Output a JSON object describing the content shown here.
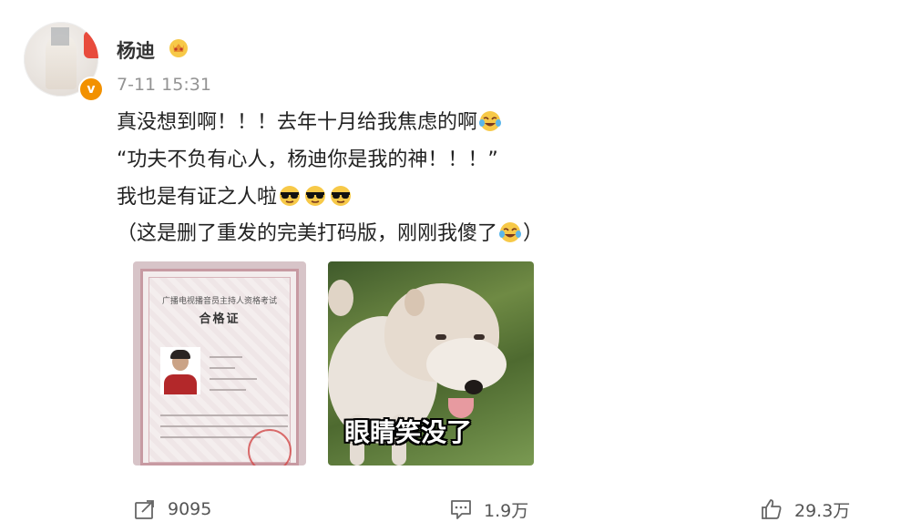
{
  "post": {
    "author": {
      "name": "杨迪",
      "verified_icon": "verified-v-icon",
      "badge_icon": "crown-emoji-icon"
    },
    "timestamp": "7-11 15:31",
    "lines": [
      "真没想到啊！！！去年十月给我焦虑的啊",
      "“功夫不负有心人，杨迪你是我的神！！！”",
      "我也是有证之人啦",
      "（这是删了重发的完美打码版，刚刚我傻了",
      "）"
    ],
    "emojis": {
      "laugh_cry": "laugh-cry-emoji-icon",
      "sunglasses": "sunglasses-emoji-icon"
    },
    "images": [
      {
        "name": "certificate",
        "title_small": "广播电视播音员主持人资格考试",
        "title_big": "合格证"
      },
      {
        "name": "dog-meme",
        "caption": "眼睛笑没了"
      }
    ],
    "actions": {
      "repost": {
        "icon": "repost-icon",
        "count": "9095"
      },
      "comment": {
        "icon": "comment-icon",
        "count": "1.9万"
      },
      "like": {
        "icon": "like-icon",
        "count": "29.3万"
      }
    }
  },
  "colors": {
    "accent_orange": "#f29100",
    "timestamp_gray": "#939393",
    "text": "#222222"
  }
}
